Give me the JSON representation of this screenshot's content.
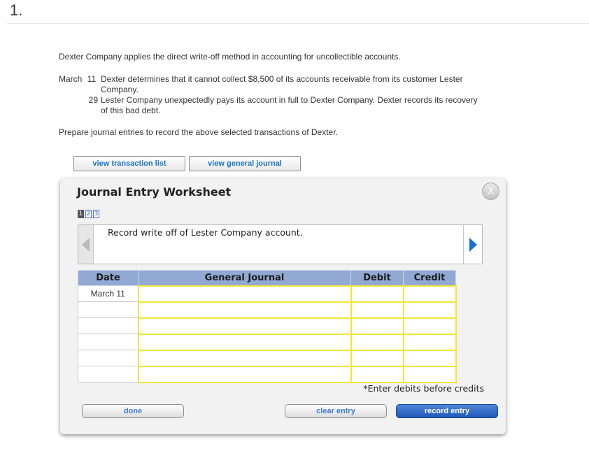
{
  "question_number": "1.",
  "intro": "Dexter Company applies the direct write-off method in accounting for uncollectible accounts.",
  "transactions": [
    {
      "month": "March",
      "day": "11",
      "text": "Dexter determines that it cannot collect $8,500 of its accounts receivable from its customer Lester Company."
    },
    {
      "month": "",
      "day": "29",
      "text": "Lester Company unexpectedly pays its account in full to Dexter Company. Dexter records its recovery of this bad debt."
    }
  ],
  "prepare_text": "Prepare journal entries to record the above selected transactions of Dexter.",
  "buttons": {
    "view_transaction_list": "view transaction list",
    "view_general_journal": "view general journal"
  },
  "worksheet": {
    "title": "Journal Entry Worksheet",
    "close_label": "X",
    "pages": [
      "1",
      "2",
      "3"
    ],
    "active_page": "1",
    "description": "Record write off of Lester Company account.",
    "columns": [
      "Date",
      "General Journal",
      "Debit",
      "Credit"
    ],
    "rows": [
      {
        "date": "March 11",
        "account": "",
        "debit": "",
        "credit": ""
      },
      {
        "date": "",
        "account": "",
        "debit": "",
        "credit": ""
      },
      {
        "date": "",
        "account": "",
        "debit": "",
        "credit": ""
      },
      {
        "date": "",
        "account": "",
        "debit": "",
        "credit": ""
      },
      {
        "date": "",
        "account": "",
        "debit": "",
        "credit": ""
      },
      {
        "date": "",
        "account": "",
        "debit": "",
        "credit": ""
      }
    ],
    "note": "*Enter debits before credits",
    "done_label": "done",
    "clear_entry_label": "clear entry",
    "record_entry_label": "record entry"
  }
}
